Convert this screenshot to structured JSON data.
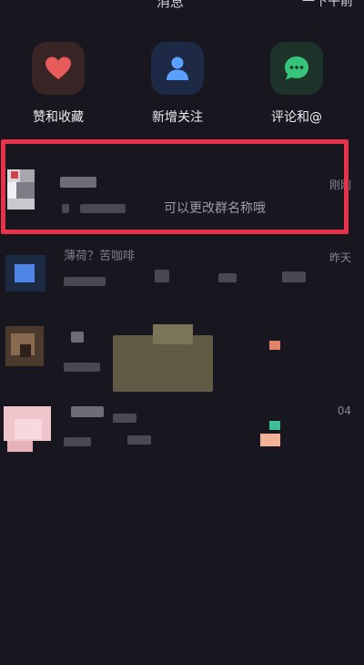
{
  "header": {
    "title": "消息",
    "right_action": "一下午前"
  },
  "shortcuts": [
    {
      "label": "赞和收藏",
      "icon": "heart-icon",
      "color": "#e85b5b"
    },
    {
      "label": "新增关注",
      "icon": "person-icon",
      "color": "#5aa0ff"
    },
    {
      "label": "评论和@",
      "icon": "chat-bubble-icon",
      "color": "#36c37a"
    }
  ],
  "conversations": [
    {
      "time": "刚刚",
      "preview": "可以更改群名称哦"
    },
    {
      "time": "昨天",
      "name": "薄荷？苦咖啡"
    },
    {
      "time": ""
    },
    {
      "time": "04"
    }
  ],
  "colors": {
    "highlight": "#e8324a",
    "background": "#18171f"
  }
}
